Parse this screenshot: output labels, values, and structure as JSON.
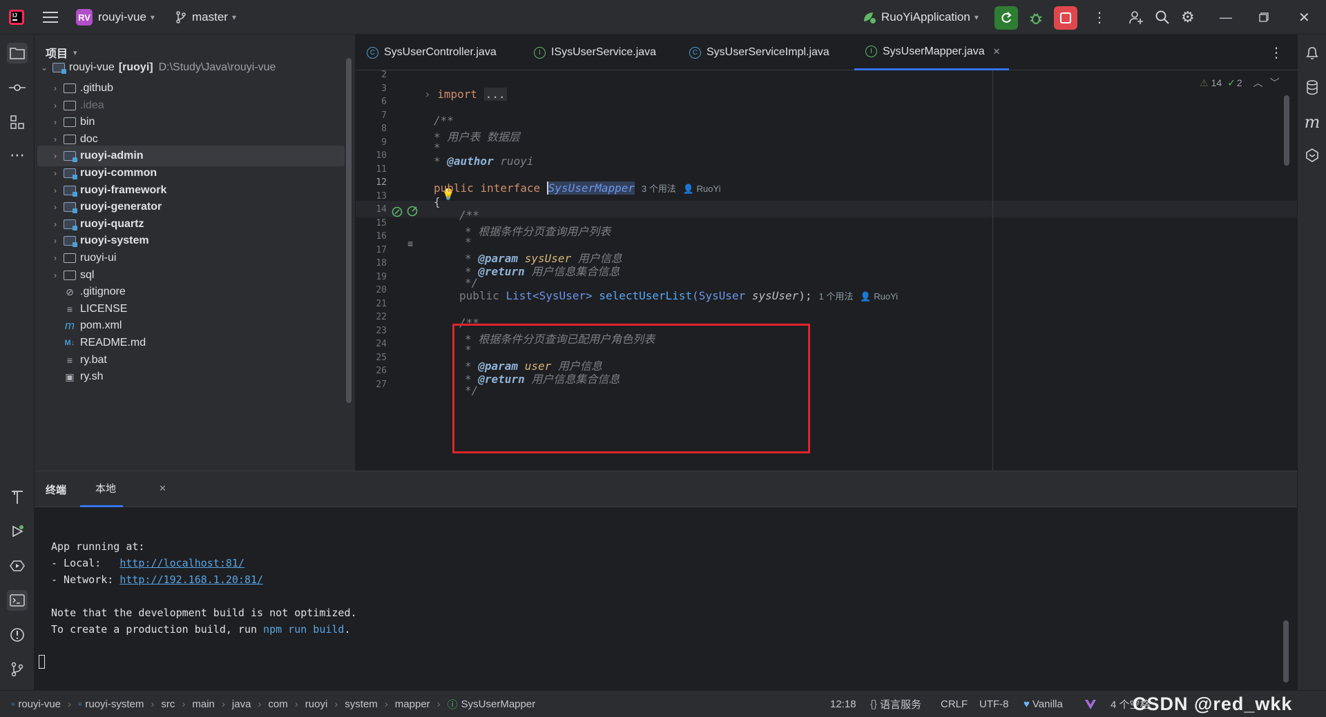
{
  "title_bar": {
    "project_badge": "RV",
    "project_name": "rouyi-vue",
    "branch": "master",
    "run_config": "RuoYiApplication"
  },
  "project_panel": {
    "header": "项目",
    "root": {
      "name": "rouyi-vue",
      "module": "[ruoyi]",
      "path": "D:\\Study\\Java\\rouyi-vue"
    },
    "items": [
      {
        "label": ".github"
      },
      {
        "label": ".idea"
      },
      {
        "label": "bin"
      },
      {
        "label": "doc"
      },
      {
        "label": "ruoyi-admin"
      },
      {
        "label": "ruoyi-common"
      },
      {
        "label": "ruoyi-framework"
      },
      {
        "label": "ruoyi-generator"
      },
      {
        "label": "ruoyi-quartz"
      },
      {
        "label": "ruoyi-system"
      },
      {
        "label": "ruoyi-ui"
      },
      {
        "label": "sql"
      },
      {
        "label": ".gitignore"
      },
      {
        "label": "LICENSE"
      },
      {
        "label": "pom.xml"
      },
      {
        "label": "README.md"
      },
      {
        "label": "ry.bat"
      },
      {
        "label": "ry.sh"
      }
    ]
  },
  "tabs": [
    {
      "label": "SysUserController.java"
    },
    {
      "label": "ISysUserService.java"
    },
    {
      "label": "SysUserServiceImpl.java"
    },
    {
      "label": "SysUserMapper.java"
    }
  ],
  "editor": {
    "inspection_warnings": "14",
    "inspection_ok": "2",
    "line_numbers": [
      "2",
      "3",
      "6",
      "7",
      "8",
      "9",
      "10",
      "11",
      "12",
      "13",
      "14",
      "15",
      "16",
      "17",
      "18",
      "19",
      "20",
      "21",
      "22",
      "23",
      "24",
      "25",
      "26",
      "27"
    ],
    "import_kw": "import",
    "import_dots": "...",
    "doc_open": "/**",
    "doc_desc": "* 用户表 数据层",
    "doc_star": "*",
    "author_tag": "@author",
    "author_val": "ruoyi",
    "public_kw": "public",
    "interface_kw": "interface",
    "class_name": "SysUserMapper",
    "class_usages": "3 个用法",
    "class_author": "RuoYi",
    "brace_open": "{",
    "m1_doc_open": "/**",
    "m1_desc": "* 根据条件分页查询用户列表",
    "m1_star": "*",
    "m1_param_tag": "@param",
    "m1_param_name": "sysUser",
    "m1_param_desc": "用户信息",
    "m1_return_tag": "@return",
    "m1_return_desc": "用户信息集合信息",
    "m1_doc_close": "*/",
    "m1_sig_public": "public",
    "m1_sig_type": "List<SysUser>",
    "m1_sig_name": "selectUserList",
    "m1_sig_ptype": "(SysUser",
    "m1_sig_pname": "sysUser",
    "m1_sig_end": ");",
    "m1_usages": "1 个用法",
    "m1_author": "RuoYi",
    "m2_doc_open": "/**",
    "m2_desc": "* 根据条件分页查询已配用户角色列表",
    "m2_star": "*",
    "m2_param_tag": "@param",
    "m2_param_name": "user",
    "m2_param_desc": "用户信息",
    "m2_return_tag": "@return",
    "m2_return_desc": "用户信息集合信息",
    "m2_doc_close": "*/"
  },
  "terminal": {
    "tab_terminal": "终端",
    "tab_local": "本地",
    "lines": {
      "l1": "App running at:",
      "l2_prefix": "- Local:   ",
      "l2_link": "http://localhost:81/",
      "l3_prefix": "- Network: ",
      "l3_link": "http://192.168.1.20:81/",
      "l4": "Note that the development build is not optimized.",
      "l5_prefix": "To create a production build, run ",
      "l5_cmd": "npm run build",
      "l5_suffix": "."
    }
  },
  "status_bar": {
    "breadcrumbs": [
      "rouyi-vue",
      "ruoyi-system",
      "src",
      "main",
      "java",
      "com",
      "ruoyi",
      "system",
      "mapper",
      "SysUserMapper"
    ],
    "position": "12:18",
    "lang_service": "语言服务",
    "line_ending": "CRLF",
    "encoding": "UTF-8",
    "theme": "Vanilla",
    "indent": "4 个空格",
    "watermark": "CSDN @red_wkk"
  },
  "colors": {
    "accent": "#3574f0",
    "highlight_box": "#e0242b",
    "run_green": "#2e7d32",
    "stop_red": "#e0474c"
  }
}
